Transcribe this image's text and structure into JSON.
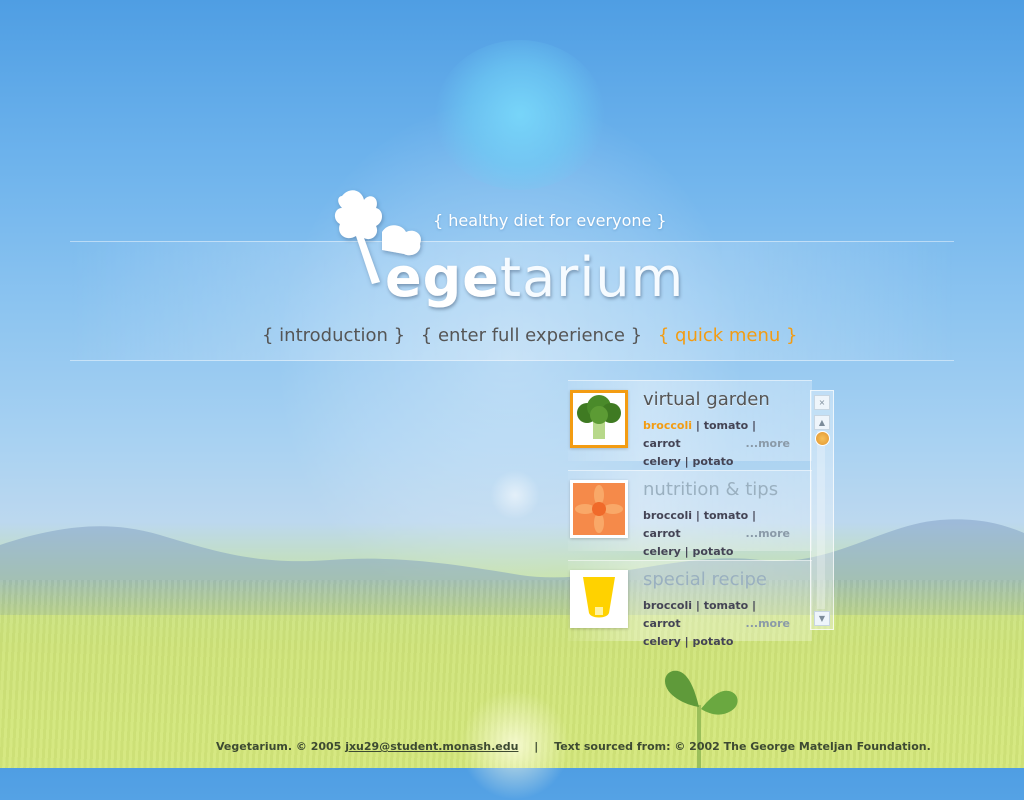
{
  "header": {
    "tagline": "{ healthy diet for everyone }",
    "brand_part1": "ege",
    "brand_part2": "tarium"
  },
  "nav": {
    "items": [
      {
        "label": "{ introduction }"
      },
      {
        "label": "{ enter full experience }"
      },
      {
        "label": "{ quick menu }",
        "active": true
      }
    ]
  },
  "quick_menu": {
    "cards": [
      {
        "title": "virtual garden",
        "links": [
          "broccoli",
          "tomato",
          "carrot",
          "celery",
          "potato"
        ],
        "more": "...more",
        "thumb_icon": "broccoli-icon",
        "active": true,
        "highlighted_link": "broccoli"
      },
      {
        "title": "nutrition & tips",
        "links": [
          "broccoli",
          "tomato",
          "carrot",
          "celery",
          "potato"
        ],
        "more": "...more",
        "thumb_icon": "flower-icon"
      },
      {
        "title": "special recipe",
        "links": [
          "broccoli",
          "tomato",
          "carrot",
          "celery",
          "potato"
        ],
        "more": "...more",
        "thumb_icon": "yellow-glass-icon"
      }
    ],
    "scrollbar": {
      "close_glyph": "×",
      "up_glyph": "▲",
      "down_glyph": "▼"
    }
  },
  "footer": {
    "copyright": "Vegetarium. © 2005",
    "email": "jxu29@student.monash.edu",
    "separator": "|",
    "source": "Text sourced from: © 2002 The George Mateljan Foundation."
  },
  "colors": {
    "accent": "#f39c12",
    "nav_text": "#555555",
    "footer_text": "#3d4a32"
  }
}
